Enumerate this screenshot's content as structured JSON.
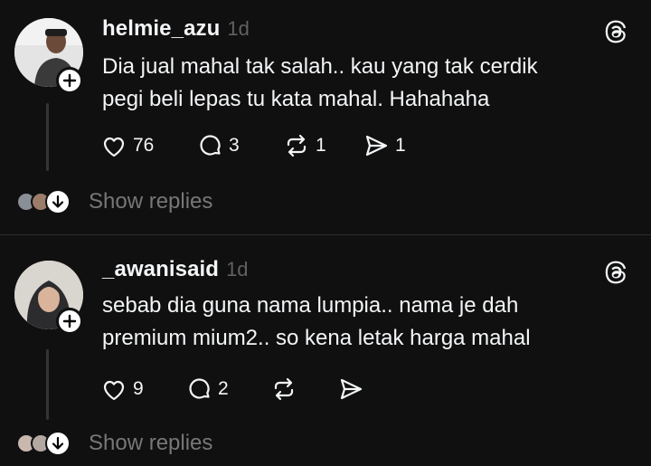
{
  "posts": [
    {
      "username": "helmie_azu",
      "time": "1d",
      "text_lines": [
        "Dia jual mahal tak salah.. kau yang tak cerdik",
        "pegi beli lepas tu kata mahal. Hahahaha"
      ],
      "likes": "76",
      "comments": "3",
      "reposts": "1",
      "shares": "1",
      "show_replies": "Show replies",
      "avatar_color": "#e6e6e6"
    },
    {
      "username": "_awanisaid",
      "time": "1d",
      "text_lines": [
        "sebab dia guna nama lumpia.. nama je dah",
        "premium mium2.. so kena letak harga mahal"
      ],
      "likes": "9",
      "comments": "2",
      "reposts": "",
      "shares": "",
      "show_replies": "Show replies",
      "avatar_color": "#d8d4cf"
    }
  ],
  "colors": {
    "background": "#101010",
    "text": "#f3f5f7",
    "muted": "#616161",
    "divider": "#2d2d2d"
  }
}
